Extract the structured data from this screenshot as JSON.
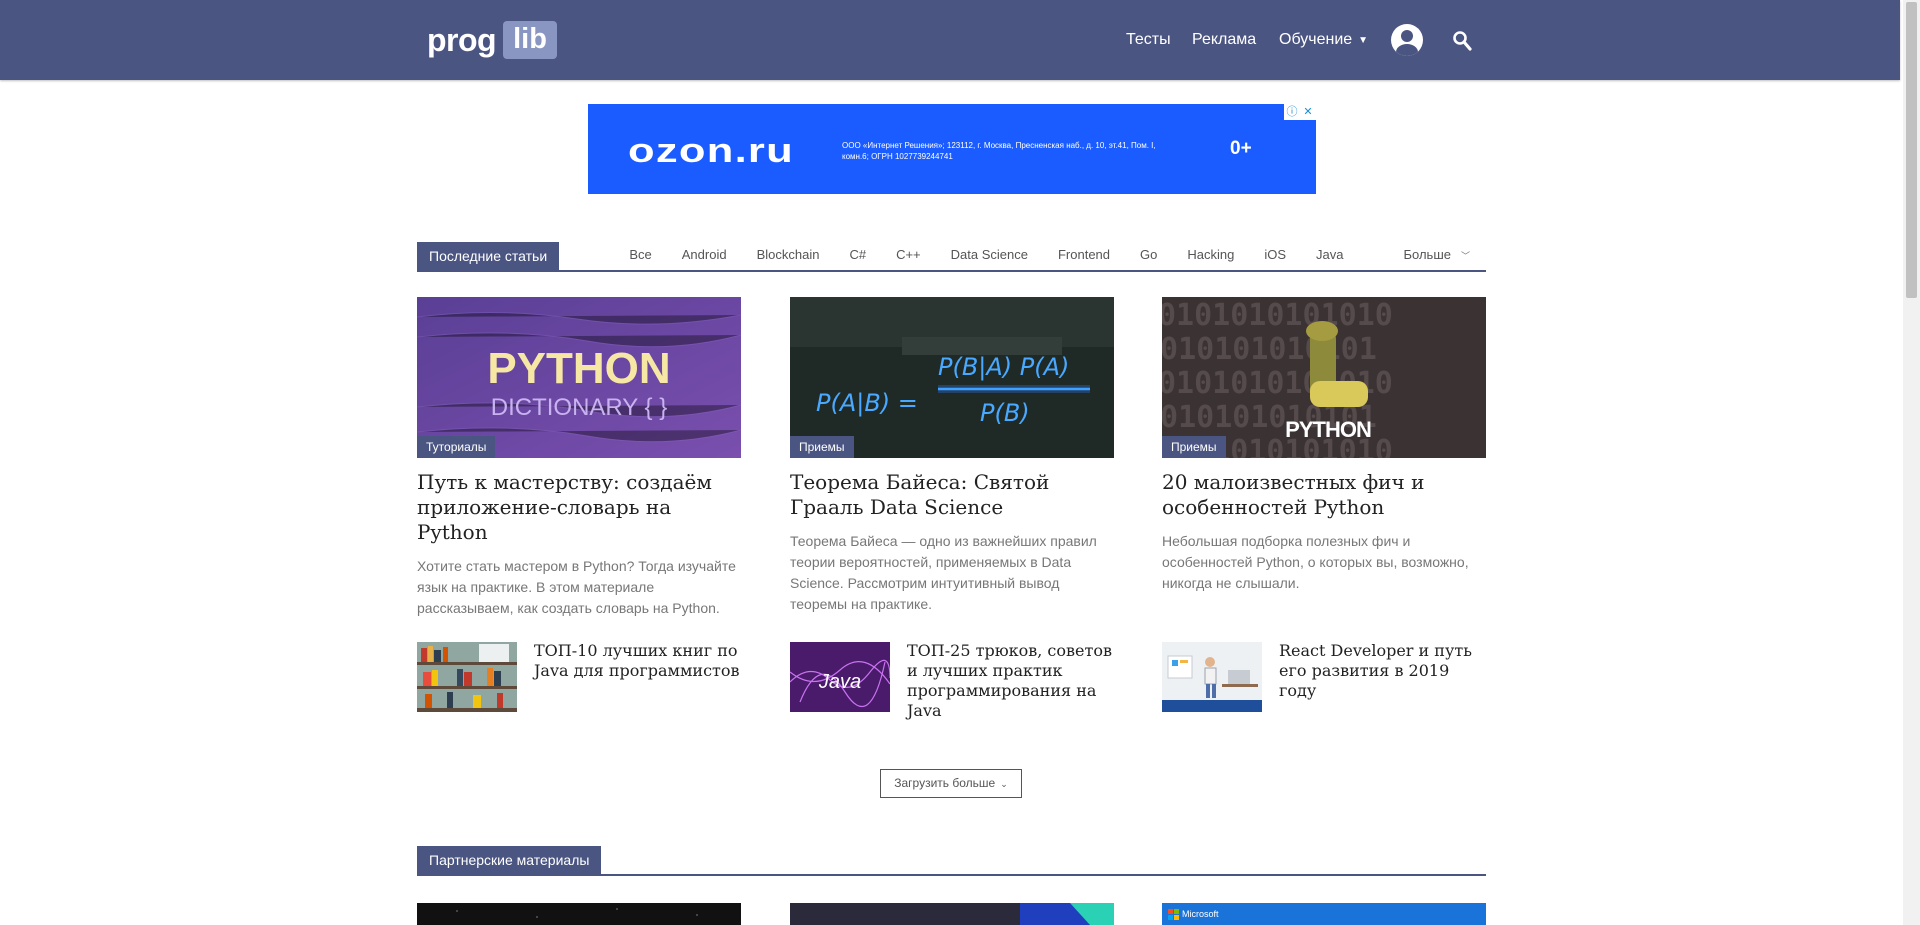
{
  "header": {
    "logo_left": "prog",
    "logo_right": "lib",
    "nav": [
      {
        "label": "Тесты"
      },
      {
        "label": "Реклама"
      },
      {
        "label": "Обучение"
      }
    ],
    "colors": {
      "header": "#4b5582",
      "accent": "#8a96c2"
    }
  },
  "ad": {
    "brand": "OZON.RU",
    "legal": "ООО «Интернет Решения»; 123112, г. Москва, Пресненская наб., д. 10, эт.41, Пом. I, комн.6; ОГРН 1027739244741",
    "age": "0+"
  },
  "latest": {
    "title": "Последние статьи",
    "categories": [
      "Все",
      "Android",
      "Blockchain",
      "C#",
      "C++",
      "Data Science",
      "Frontend",
      "Go",
      "Hacking",
      "iOS",
      "Java",
      "Больше"
    ]
  },
  "articles": [
    {
      "badge": "Туториалы",
      "image_text": [
        "PYTHON",
        "DICTIONARY { }"
      ],
      "title": "Путь к мастерству: создаём приложение-словарь на Python",
      "desc": "Хотите стать мастером в Python? Тогда изучайте язык на практике. В этом материале рассказываем, как создать словарь на Python."
    },
    {
      "badge": "Приемы",
      "image_text": [
        "P(A|B) =",
        "P(B|A) P(A)",
        "P(B)"
      ],
      "title": "Теорема Байеса: Святой Грааль Data Science",
      "desc": "Теорема Байеса — одно из важнейших правил теории вероятностей, применяемых в Data Science. Рассмотрим интуитивный вывод теоремы на практике."
    },
    {
      "badge": "Приемы",
      "image_text": [
        "PYTHON"
      ],
      "title": "20 малоизвестных фич и особенностей Python",
      "desc": "Небольшая подборка полезных фич и особенностей Python, о которых вы, возможно, никогда не слышали."
    }
  ],
  "mini": [
    {
      "title": "ТОП-10 лучших книг по Java для программистов"
    },
    {
      "title": "ТОП-25 трюков, советов и лучших практик программирования на Java",
      "image_text": "Java"
    },
    {
      "title": "React Developer и путь его развития в 2019 году"
    }
  ],
  "load_more": "Загрузить больше",
  "partner": {
    "title": "Партнерские материалы",
    "brand": "Microsoft"
  }
}
